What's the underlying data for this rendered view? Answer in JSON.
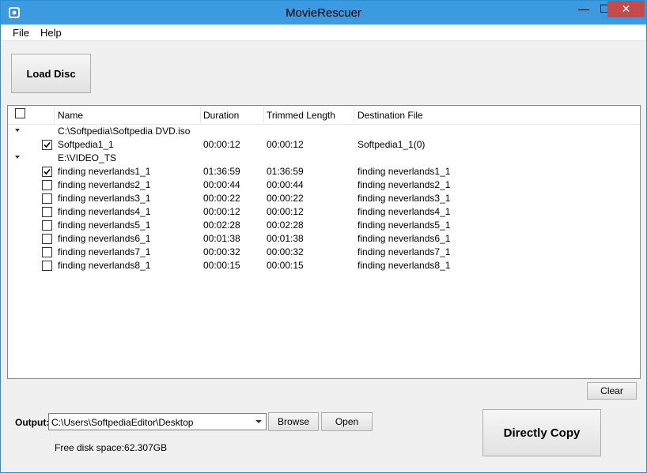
{
  "window": {
    "title": "MovieRescuer",
    "accent": "#3b9ae0"
  },
  "titlebar": {
    "minimize": "—",
    "maximize": "☐",
    "close": "✕"
  },
  "menu": [
    "File",
    "Help"
  ],
  "toolbar": {
    "load_disc": "Load Disc"
  },
  "list": {
    "columns": [
      "Name",
      "Duration",
      "Trimmed Length",
      "Destination File"
    ],
    "groups": [
      {
        "path": "C:\\Softpedia\\Softpedia DVD.iso",
        "items": [
          {
            "checked": true,
            "name": "Softpedia1_1",
            "duration": "00:00:12",
            "trimmed": "00:00:12",
            "dest": "Softpedia1_1(0)"
          }
        ]
      },
      {
        "path": "E:\\VIDEO_TS",
        "items": [
          {
            "checked": true,
            "name": "finding neverlands1_1",
            "duration": "01:36:59",
            "trimmed": "01:36:59",
            "dest": "finding neverlands1_1"
          },
          {
            "checked": false,
            "name": "finding neverlands2_1",
            "duration": "00:00:44",
            "trimmed": "00:00:44",
            "dest": "finding neverlands2_1"
          },
          {
            "checked": false,
            "name": "finding neverlands3_1",
            "duration": "00:00:22",
            "trimmed": "00:00:22",
            "dest": "finding neverlands3_1"
          },
          {
            "checked": false,
            "name": "finding neverlands4_1",
            "duration": "00:00:12",
            "trimmed": "00:00:12",
            "dest": "finding neverlands4_1"
          },
          {
            "checked": false,
            "name": "finding neverlands5_1",
            "duration": "00:02:28",
            "trimmed": "00:02:28",
            "dest": "finding neverlands5_1"
          },
          {
            "checked": false,
            "name": "finding neverlands6_1",
            "duration": "00:01:38",
            "trimmed": "00:01:38",
            "dest": "finding neverlands6_1"
          },
          {
            "checked": false,
            "name": "finding neverlands7_1",
            "duration": "00:00:32",
            "trimmed": "00:00:32",
            "dest": "finding neverlands7_1"
          },
          {
            "checked": false,
            "name": "finding neverlands8_1",
            "duration": "00:00:15",
            "trimmed": "00:00:15",
            "dest": "finding neverlands8_1"
          }
        ]
      }
    ]
  },
  "actions": {
    "clear": "Clear",
    "browse": "Browse",
    "open": "Open",
    "directly_copy": "Directly Copy"
  },
  "output": {
    "label": "Output:",
    "path": "C:\\Users\\SoftpediaEditor\\Desktop",
    "free_space": "Free disk space:62.307GB"
  }
}
